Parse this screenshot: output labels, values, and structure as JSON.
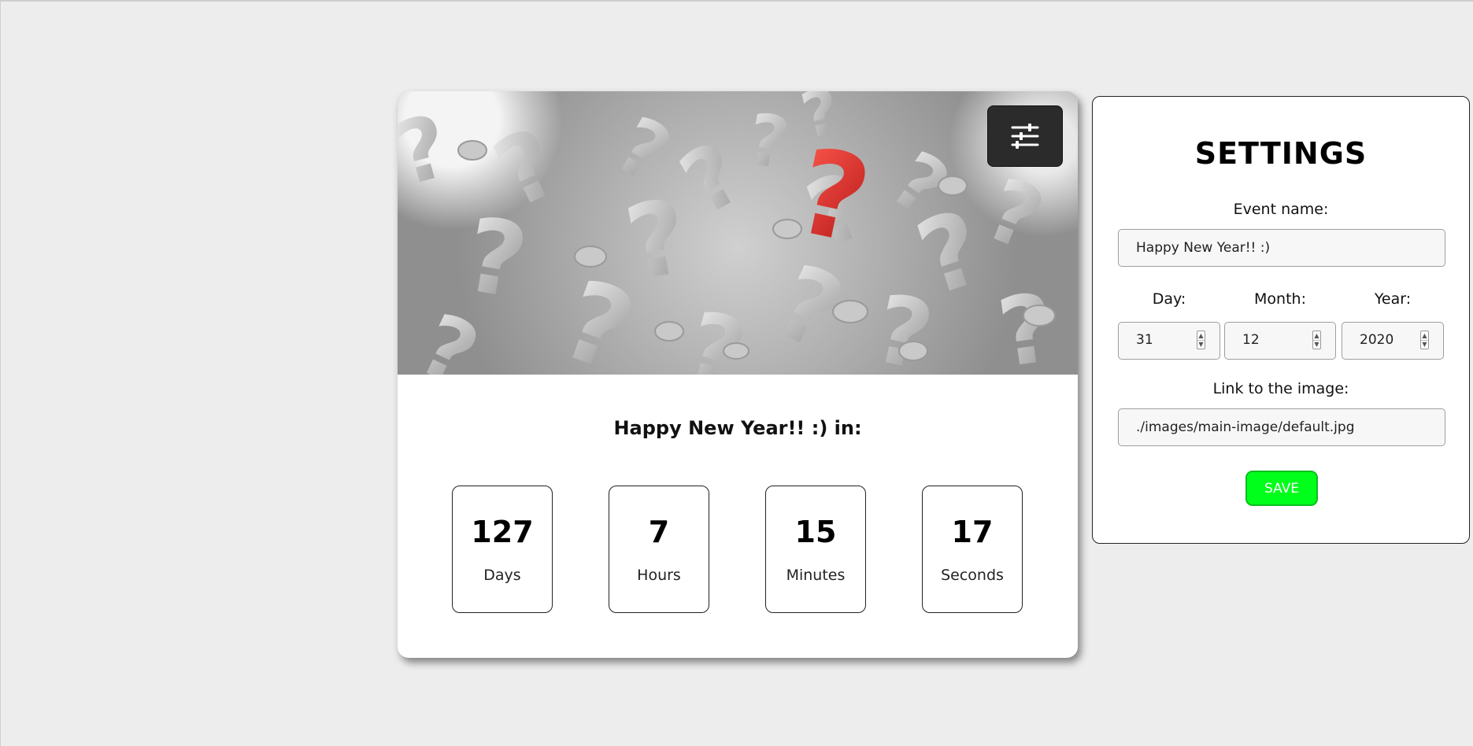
{
  "countdown": {
    "title": "Happy New Year!! :) in:",
    "counters": [
      {
        "value": "127",
        "unit": "Days"
      },
      {
        "value": "7",
        "unit": "Hours"
      },
      {
        "value": "15",
        "unit": "Minutes"
      },
      {
        "value": "17",
        "unit": "Seconds"
      }
    ],
    "settings_toggle_icon": "sliders-icon"
  },
  "settings": {
    "title": "SETTINGS",
    "event_name_label": "Event name:",
    "event_name_value": "Happy New Year!! :)",
    "day_label": "Day:",
    "day_value": "31",
    "month_label": "Month:",
    "month_value": "12",
    "year_label": "Year:",
    "year_value": "2020",
    "image_link_label": "Link to the image:",
    "image_link_value": "./images/main-image/default.jpg",
    "save_label": "SAVE"
  },
  "colors": {
    "background": "#ededed",
    "save_button": "#00ff1a",
    "toggle_button": "#2b2b2b",
    "accent_question_mark": "#e02a2a"
  }
}
